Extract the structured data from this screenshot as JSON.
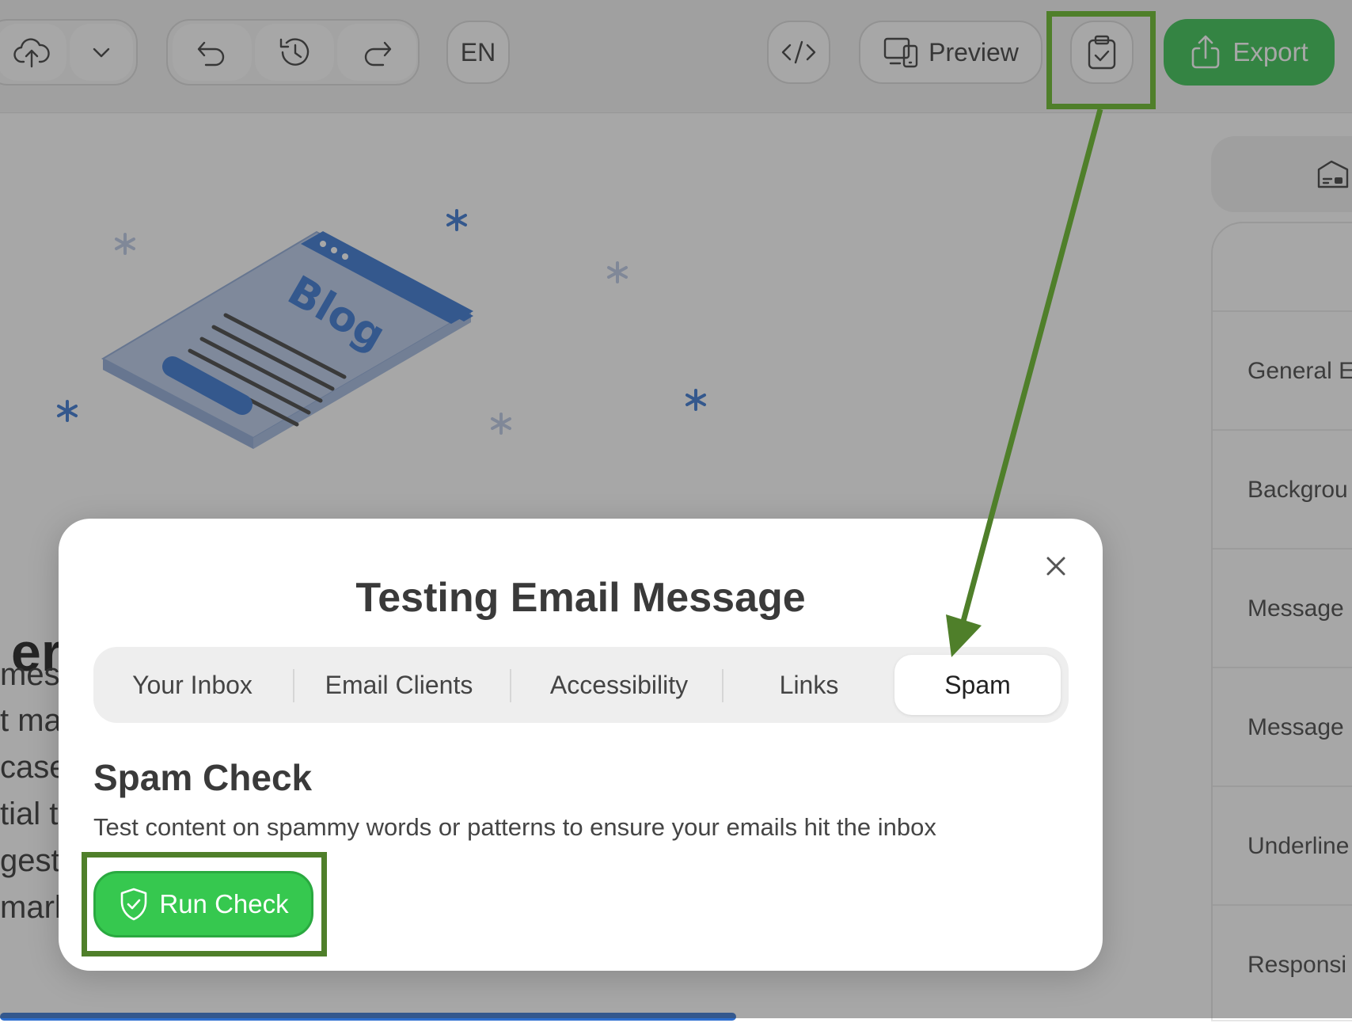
{
  "toolbar": {
    "language": "EN",
    "preview_label": "Preview",
    "export_label": "Export"
  },
  "canvas": {
    "blog_illustration_text": "Blog",
    "headline_fragment": "er",
    "body_fragments": [
      "mes",
      "t ma",
      "case",
      "tial ti",
      "gest",
      "mark"
    ]
  },
  "right_panel": {
    "items": [
      "General E",
      "Backgrou",
      "Message",
      "Message",
      "Underline",
      "Responsi"
    ]
  },
  "modal": {
    "title": "Testing Email Message",
    "tabs": [
      "Your Inbox",
      "Email Clients",
      "Accessibility",
      "Links",
      "Spam"
    ],
    "active_tab": "Spam",
    "section_title": "Spam Check",
    "section_description": "Test content on spammy words or patterns to ensure your emails hit the inbox",
    "run_button_label": "Run Check"
  },
  "colors": {
    "accent_green": "#36c84f",
    "annotation_green": "#4f7f2a",
    "blog_blue": "#2e6fd0"
  },
  "icons": [
    "upload-cloud-icon",
    "chevron-down-icon",
    "undo-icon",
    "history-icon",
    "redo-icon",
    "code-icon",
    "devices-icon",
    "clipboard-check-icon",
    "share-upload-icon",
    "close-icon",
    "shield-check-icon"
  ]
}
